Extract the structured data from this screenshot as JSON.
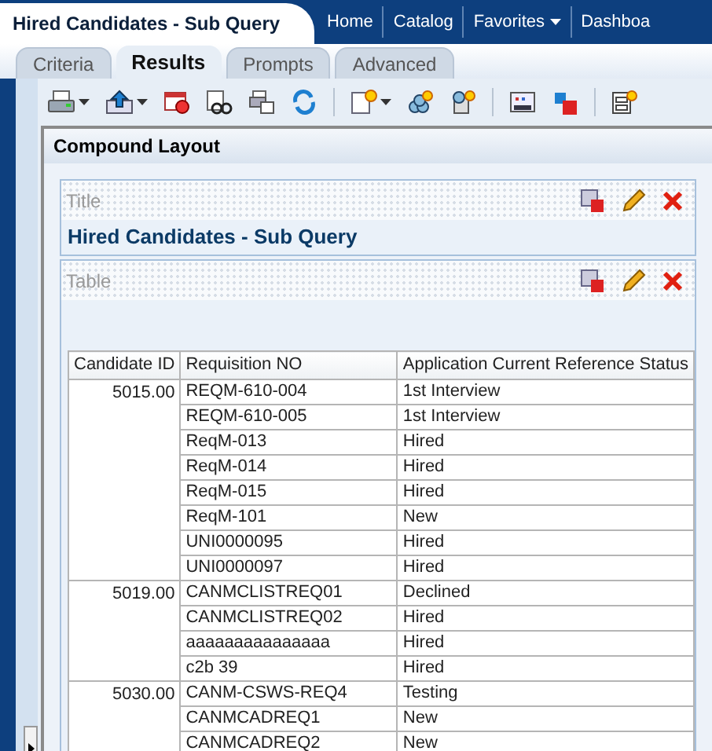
{
  "header": {
    "title": "Hired Candidates - Sub Query",
    "nav": [
      {
        "label": "Home",
        "dropdown": false
      },
      {
        "label": "Catalog",
        "dropdown": false
      },
      {
        "label": "Favorites",
        "dropdown": true
      },
      {
        "label": "Dashboa",
        "dropdown": false
      }
    ]
  },
  "tabs": [
    {
      "label": "Criteria",
      "selected": false
    },
    {
      "label": "Results",
      "selected": true
    },
    {
      "label": "Prompts",
      "selected": false
    },
    {
      "label": "Advanced",
      "selected": false
    }
  ],
  "layout": {
    "heading": "Compound Layout",
    "title_view": {
      "label": "Title",
      "text": "Hired Candidates - Sub Query"
    },
    "table_view": {
      "label": "Table"
    }
  },
  "table": {
    "columns": [
      "Candidate ID",
      "Requisition NO",
      "Application Current Reference Status"
    ],
    "groups": [
      {
        "candidate_id": "5015.00",
        "rows": [
          [
            "REQM-610-004",
            "1st Interview"
          ],
          [
            "REQM-610-005",
            "1st Interview"
          ],
          [
            "ReqM-013",
            "Hired"
          ],
          [
            "ReqM-014",
            "Hired"
          ],
          [
            "ReqM-015",
            "Hired"
          ],
          [
            "ReqM-101",
            "New"
          ],
          [
            "UNI0000095",
            "Hired"
          ],
          [
            "UNI0000097",
            "Hired"
          ]
        ]
      },
      {
        "candidate_id": "5019.00",
        "rows": [
          [
            "CANMCLISTREQ01",
            "Declined"
          ],
          [
            "CANMCLISTREQ02",
            "Hired"
          ],
          [
            "aaaaaaaaaaaaaaa",
            "Hired"
          ],
          [
            "c2b 39",
            "Hired"
          ]
        ]
      },
      {
        "candidate_id": "5030.00",
        "rows": [
          [
            "CANM-CSWS-REQ4",
            "Testing"
          ],
          [
            "CANMCADREQ1",
            "New"
          ],
          [
            "CANMCADREQ2",
            "New"
          ]
        ]
      }
    ]
  }
}
